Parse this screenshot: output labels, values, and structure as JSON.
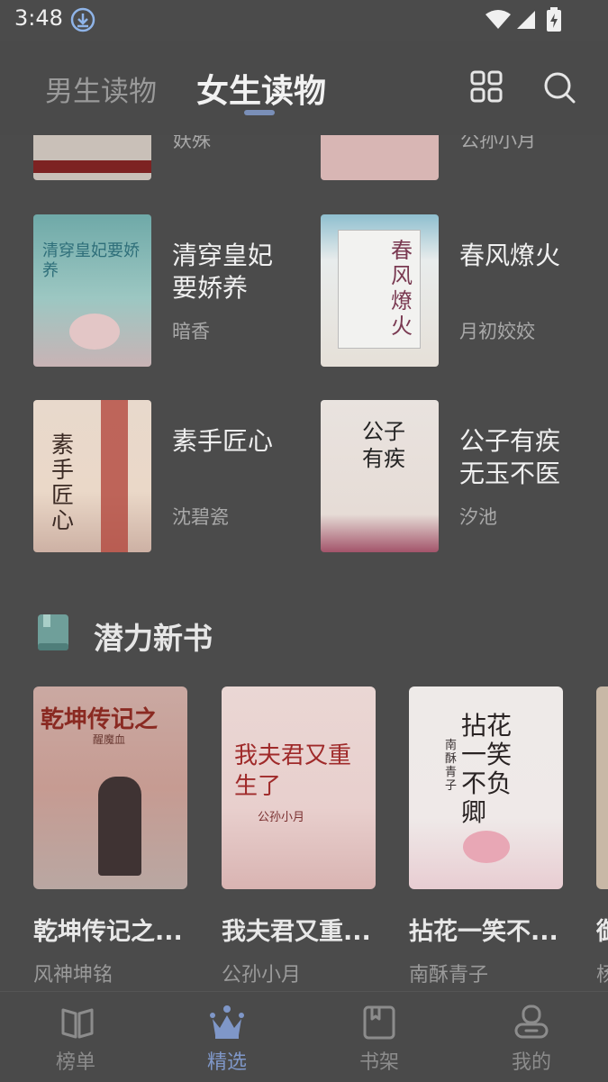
{
  "status": {
    "time": "3:48"
  },
  "header": {
    "tabs": [
      {
        "label": "男生读物",
        "active": false
      },
      {
        "label": "女生读物",
        "active": true
      }
    ]
  },
  "top_partial": [
    {
      "author": "妖殊"
    },
    {
      "author": "公孙小月"
    }
  ],
  "books_grid": [
    {
      "title_line1": "清穿皇妃",
      "title_line2": "要娇养",
      "author": "暗香",
      "cover_text": "清穿皇妃要娇养"
    },
    {
      "title_line1": "春风燎火",
      "title_line2": "",
      "author": "月初姣姣",
      "cover_text": "春风燎火"
    },
    {
      "title_line1": "素手匠心",
      "title_line2": "",
      "author": "沈碧瓷",
      "cover_text": "素手匠心"
    },
    {
      "title_line1": "公子有疾",
      "title_line2": "无玉不医",
      "author": "汐池",
      "cover_text": "公子有疾"
    }
  ],
  "section": {
    "title": "潜力新书"
  },
  "new_books": [
    {
      "title": "乾坤传记之...",
      "author": "风神坤铭",
      "cover_text": "乾坤传记之",
      "cover_sub": "醒魔血"
    },
    {
      "title": "我夫君又重...",
      "author": "公孙小月",
      "cover_text": "我夫君又重生了",
      "cover_sub": "公孙小月"
    },
    {
      "title": "拈花一笑不...",
      "author": "南酥青子",
      "cover_text": "拈花一笑不负卿",
      "cover_sub": "南酥青子"
    },
    {
      "title": "御",
      "author": "杨"
    }
  ],
  "bottom_nav": [
    {
      "label": "榜单",
      "icon": "book-open-icon",
      "active": false
    },
    {
      "label": "精选",
      "icon": "crown-icon",
      "active": true
    },
    {
      "label": "书架",
      "icon": "bookshelf-icon",
      "active": false
    },
    {
      "label": "我的",
      "icon": "user-icon",
      "active": false
    }
  ],
  "colors": {
    "accent": "#7f97c8",
    "background": "#4a4a4a"
  }
}
